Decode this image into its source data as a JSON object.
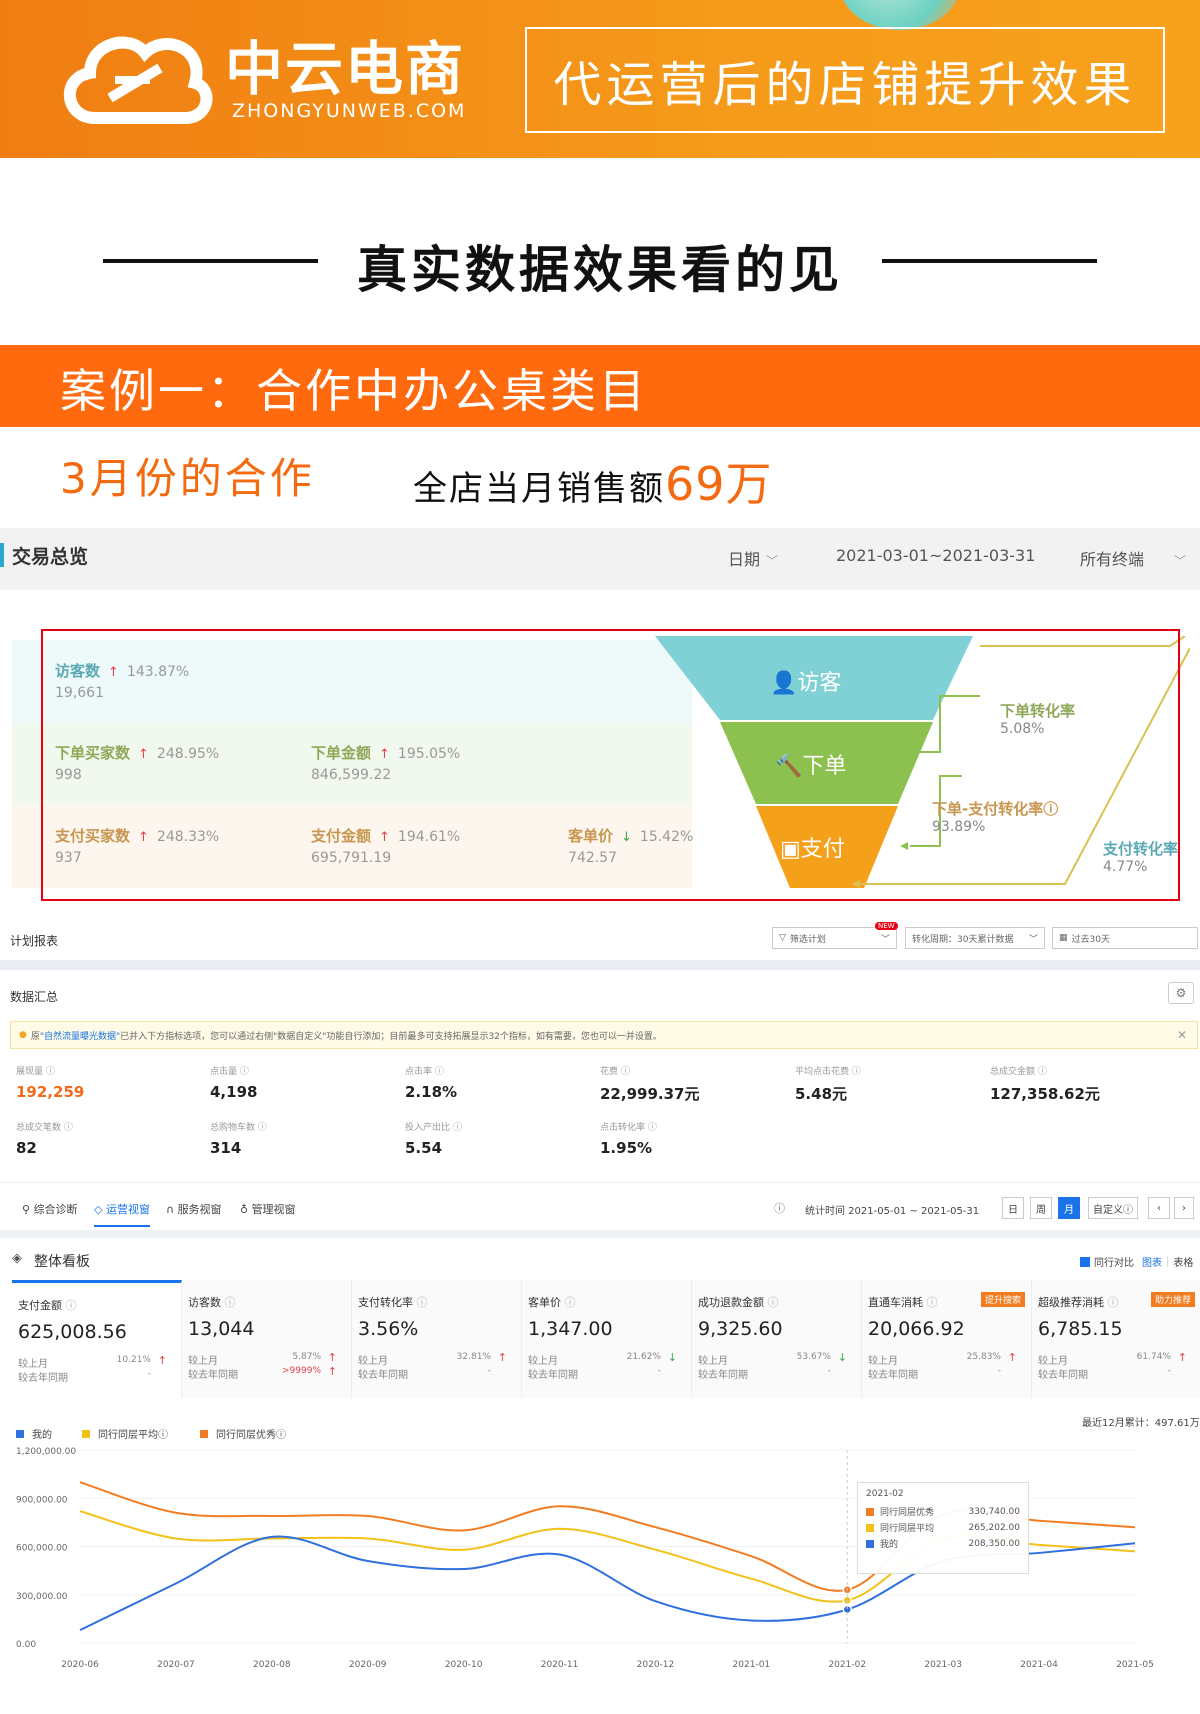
{
  "header": {
    "brand": "中云电商",
    "url": "ZHONGYUNWEB.COM",
    "slogan": "代运营后的店铺提升效果"
  },
  "section_title": "真实数据效果看的见",
  "case": {
    "title": "案例一：合作中办公桌类目",
    "month": "3月份的合作",
    "sales_label": "全店当月销售额",
    "sales_value": "69万"
  },
  "trade_overview": {
    "title": "交易总览",
    "date_label": "日期",
    "date_range": "2021-03-01~2021-03-31",
    "terminal": "所有终端",
    "rows": [
      [
        {
          "name": "访客数",
          "pct": "143.87%",
          "dir": "up",
          "value": "19,661"
        }
      ],
      [
        {
          "name": "下单买家数",
          "pct": "248.95%",
          "dir": "up",
          "value": "998"
        },
        {
          "name": "下单金额",
          "pct": "195.05%",
          "dir": "up",
          "value": "846,599.22"
        }
      ],
      [
        {
          "name": "支付买家数",
          "pct": "248.33%",
          "dir": "up",
          "value": "937"
        },
        {
          "name": "支付金额",
          "pct": "194.61%",
          "dir": "up",
          "value": "695,791.19"
        },
        {
          "name": "客单价",
          "pct": "15.42%",
          "dir": "down",
          "value": "742.57"
        }
      ]
    ],
    "funnel": [
      "访客",
      "下单",
      "支付"
    ],
    "side": [
      {
        "label": "下单转化率",
        "value": "5.08%"
      },
      {
        "label": "下单-支付转化率",
        "value": "93.89%"
      },
      {
        "label": "支付转化率",
        "value": "4.77%"
      }
    ]
  },
  "plan_report": {
    "title": "计划报表",
    "filter": "筛选计划",
    "new_badge": "NEW",
    "cycle": "转化周期：30天累计数据",
    "range": "过去30天",
    "summary_title": "数据汇总",
    "notice_pre": "原",
    "notice_link": "\"自然流量曝光数据\"",
    "notice_text": "已并入下方指标选项，您可以通过右侧\"数据自定义\"功能自行添加；目前最多可支持拓展显示32个指标，如有需要，您也可以一并设置。",
    "kpis": [
      {
        "label": "展现量",
        "value": "192,259",
        "highlight": true
      },
      {
        "label": "点击量",
        "value": "4,198"
      },
      {
        "label": "点击率",
        "value": "2.18%"
      },
      {
        "label": "花费",
        "value": "22,999.37元"
      },
      {
        "label": "平均点击花费",
        "value": "5.48元"
      },
      {
        "label": "总成交金额",
        "value": "127,358.62元"
      },
      {
        "label": "总成交笔数",
        "value": "82"
      },
      {
        "label": "总购物车数",
        "value": "314"
      },
      {
        "label": "投入产出比",
        "value": "5.54"
      },
      {
        "label": "点击转化率",
        "value": "1.95%"
      }
    ]
  },
  "tabs": [
    "综合诊断",
    "运营视窗",
    "服务视窗",
    "管理视窗"
  ],
  "stat_time": "统计时间 2021-05-01 ~ 2021-05-31",
  "period_buttons": [
    "日",
    "周",
    "月",
    "自定义"
  ],
  "board": {
    "title": "整体看板",
    "compare_label": "同行对比",
    "view_chart": "图表",
    "view_table": "表格",
    "row1_label": "较上月",
    "row2_label": "较去年同期",
    "cards": [
      {
        "name": "支付金额",
        "value": "625,008.56",
        "mom": "10.21%",
        "mom_dir": "up",
        "yoy": "-"
      },
      {
        "name": "访客数",
        "value": "13,044",
        "mom": "5.87%",
        "mom_dir": "up",
        "yoy": ">9999%",
        "yoy_dir": "up"
      },
      {
        "name": "支付转化率",
        "value": "3.56%",
        "mom": "32.81%",
        "mom_dir": "up",
        "yoy": "-"
      },
      {
        "name": "客单价",
        "value": "1,347.00",
        "mom": "21.62%",
        "mom_dir": "down",
        "yoy": "-"
      },
      {
        "name": "成功退款金额",
        "value": "9,325.60",
        "mom": "53.67%",
        "mom_dir": "down",
        "yoy": "-"
      },
      {
        "name": "直通车消耗",
        "value": "20,066.92",
        "mom": "25.83%",
        "mom_dir": "up",
        "yoy": "-",
        "tag": "提升搜索"
      },
      {
        "name": "超级推荐消耗",
        "value": "6,785.15",
        "mom": "61.74%",
        "mom_dir": "up",
        "yoy": "-",
        "tag": "助力推荐"
      }
    ],
    "total_label": "最近12月累计：497.61万"
  },
  "chart_data": {
    "type": "line",
    "x": [
      "2020-06",
      "2020-07",
      "2020-08",
      "2020-09",
      "2020-10",
      "2020-11",
      "2020-12",
      "2021-01",
      "2021-02",
      "2021-03",
      "2021-04",
      "2021-05"
    ],
    "ylim": [
      0,
      1200000
    ],
    "yticks": [
      "1,200,000.00",
      "900,000.00",
      "600,000.00",
      "300,000.00",
      "0.00"
    ],
    "series": [
      {
        "name": "我的",
        "color": "#2f6fde",
        "values": [
          80000,
          370000,
          660000,
          510000,
          460000,
          550000,
          260000,
          140000,
          208350,
          510000,
          560000,
          620000
        ]
      },
      {
        "name": "同行同层平均",
        "color": "#f2c21a",
        "values": [
          820000,
          650000,
          650000,
          650000,
          580000,
          710000,
          580000,
          400000,
          265202,
          650000,
          610000,
          570000
        ]
      },
      {
        "name": "同行同层优秀",
        "color": "#f27c22",
        "values": [
          1000000,
          810000,
          790000,
          790000,
          700000,
          850000,
          720000,
          540000,
          330740,
          800000,
          760000,
          720000
        ]
      }
    ],
    "tooltip": {
      "title": "2021-02",
      "rows": [
        {
          "name": "同行同层优秀",
          "value": "330,740.00",
          "color": "#f27c22"
        },
        {
          "name": "同行同层平均",
          "value": "265,202.00",
          "color": "#f2c21a"
        },
        {
          "name": "我的",
          "value": "208,350.00",
          "color": "#2f6fde"
        }
      ]
    }
  }
}
